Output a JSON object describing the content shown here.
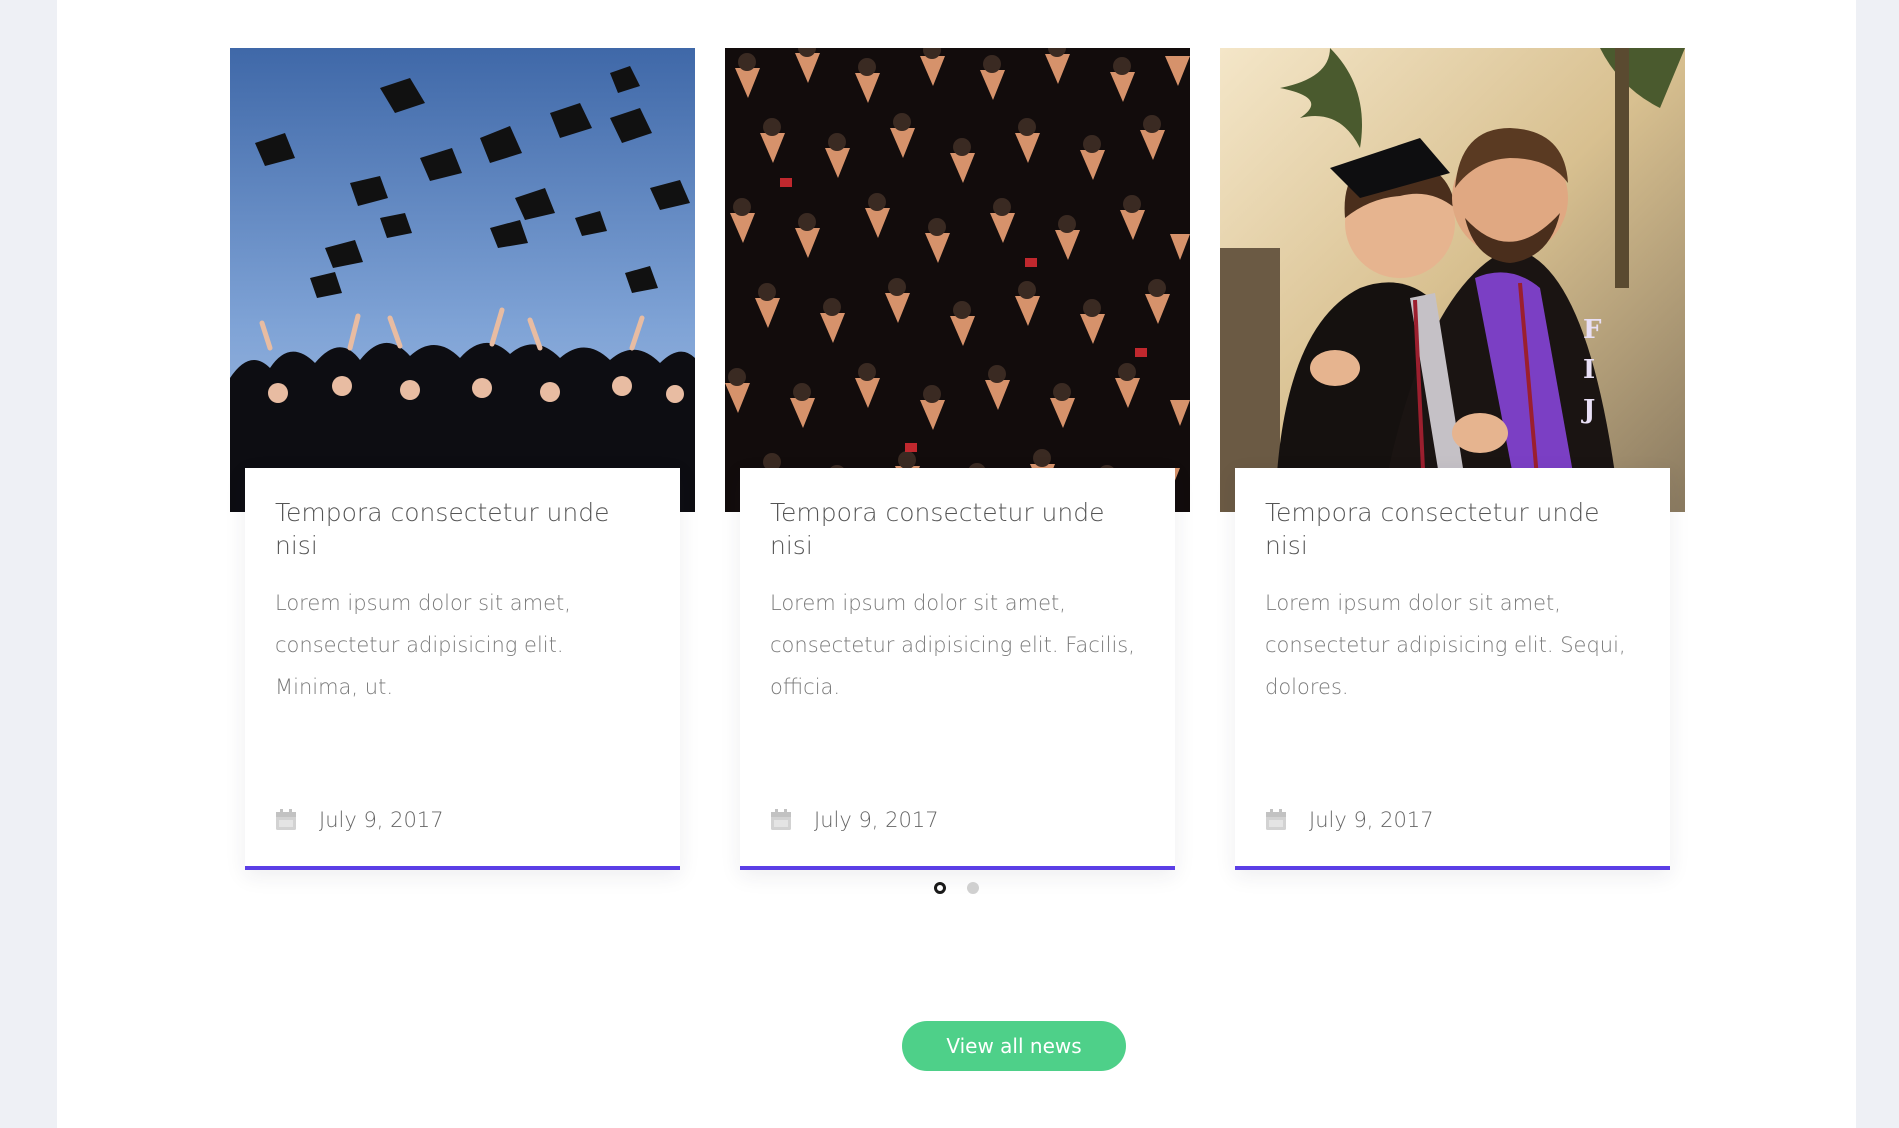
{
  "colors": {
    "accent": "#5b3ee6",
    "button": "#4ed089",
    "background": "#eef0f5"
  },
  "news": {
    "cards": [
      {
        "image": "graduation-caps-thrown",
        "title": "Tempora consectetur unde nisi",
        "excerpt": "Lorem ipsum dolor sit amet, consectetur adipisicing elit. Minima, ut.",
        "date_icon": "calendar-icon",
        "date": "July 9, 2017"
      },
      {
        "image": "graduates-crowd-overhead",
        "title": "Tempora consectetur unde nisi",
        "excerpt": "Lorem ipsum dolor sit amet, consectetur adipisicing elit. Facilis, officia.",
        "date_icon": "calendar-icon",
        "date": "July 9, 2017"
      },
      {
        "image": "graduate-couple-embrace",
        "title": "Tempora consectetur unde nisi",
        "excerpt": "Lorem ipsum dolor sit amet, consectetur adipisicing elit. Sequi, dolores.",
        "date_icon": "calendar-icon",
        "date": "July 9, 2017"
      }
    ],
    "carousel": {
      "page_count": 2,
      "active_page": 1
    },
    "view_all_label": "View all news"
  }
}
